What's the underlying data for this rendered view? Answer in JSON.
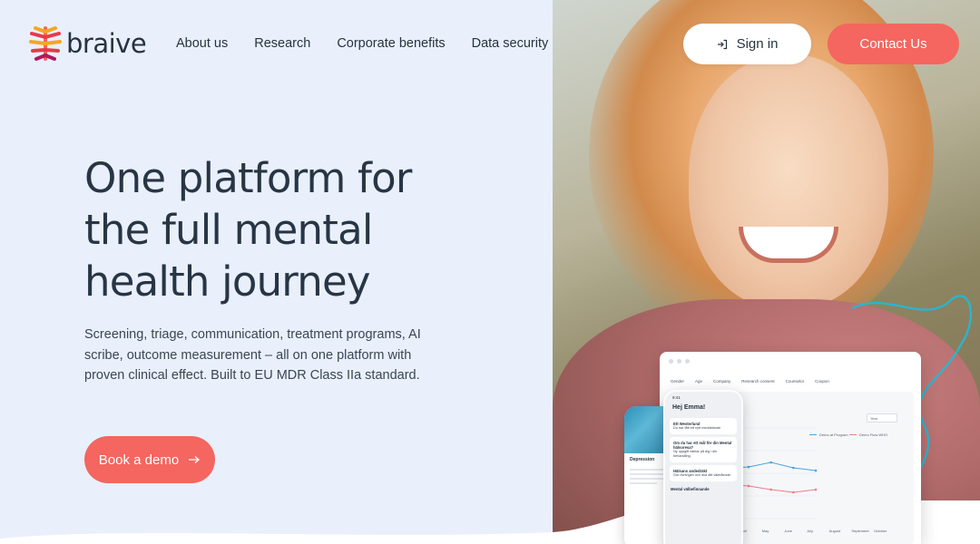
{
  "brand": {
    "name": "braive",
    "accent": "#f4665f",
    "text_color": "#263340"
  },
  "nav": {
    "items": [
      {
        "label": "About us"
      },
      {
        "label": "Research"
      },
      {
        "label": "Corporate benefits"
      },
      {
        "label": "Data security"
      }
    ],
    "signin_label": "Sign in",
    "contact_label": "Contact Us"
  },
  "hero": {
    "title_line1": "One platform for",
    "title_line2": "the full mental",
    "title_line3": "health journey",
    "subtitle": "Screening, triage, communication, treatment programs, AI scribe, outcome measurement – all on one platform with proven clinical effect. Built to EU MDR Class IIa standard.",
    "cta_label": "Book a demo"
  },
  "dashboard": {
    "filters": [
      "Gender",
      "Age",
      "Company",
      "Research consent",
      "Counselor",
      "Coupon"
    ],
    "legend": [
      "Demo at Program",
      "Demo Flow WHO"
    ],
    "months": [
      "April",
      "May",
      "June",
      "July",
      "August",
      "September",
      "October"
    ],
    "period": "Year",
    "series": [
      {
        "name": "Demo at Program",
        "color": "#4aa3df",
        "values": [
          0.45,
          0.52,
          0.55,
          0.57,
          0.62,
          0.56,
          0.53
        ]
      },
      {
        "name": "Demo Flow WHO",
        "color": "#f07a8c",
        "values": [
          0.62,
          0.5,
          0.38,
          0.36,
          0.32,
          0.29,
          0.32
        ]
      }
    ]
  },
  "phone_front": {
    "time": "9:41",
    "greeting": "Hej Emma!",
    "card1_title": "Ett Westerlund",
    "card1_text": "Du har fått ett nytt meddelande",
    "card2_title": "Om du har ett mål för din Mental hälsoresa?",
    "card2_text": "Ny uppgift väntar på dig i din behandling.",
    "card3_title": "Hälsans andedräkt",
    "card3_text": "Gör övningen och öka ditt välmående.",
    "section": "Mental välbefinnande"
  },
  "phone_back": {
    "title": "Depression"
  }
}
